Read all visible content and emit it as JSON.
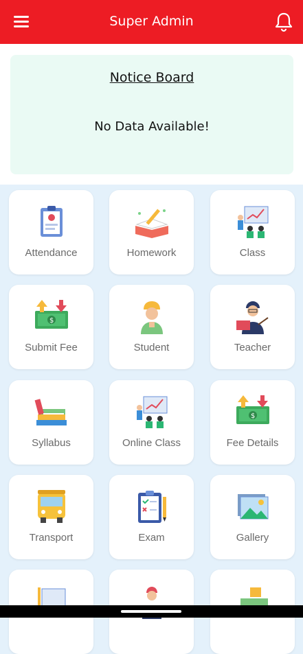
{
  "header": {
    "title": "Super Admin",
    "menu_icon": "hamburger-icon",
    "notification_icon": "bell-icon",
    "bg_color": "#ed1c24"
  },
  "notice_board": {
    "title": "Notice Board",
    "message": "No Data Available!"
  },
  "tiles": [
    {
      "label": "Attendance",
      "icon": "attendance-icon"
    },
    {
      "label": "Homework",
      "icon": "homework-icon"
    },
    {
      "label": "Class",
      "icon": "class-icon"
    },
    {
      "label": "Submit Fee",
      "icon": "submit-fee-icon"
    },
    {
      "label": "Student",
      "icon": "student-icon"
    },
    {
      "label": "Teacher",
      "icon": "teacher-icon"
    },
    {
      "label": "Syllabus",
      "icon": "syllabus-icon"
    },
    {
      "label": "Online Class",
      "icon": "online-class-icon"
    },
    {
      "label": "Fee Details",
      "icon": "fee-details-icon"
    },
    {
      "label": "Transport",
      "icon": "transport-icon"
    },
    {
      "label": "Exam",
      "icon": "exam-icon"
    },
    {
      "label": "Gallery",
      "icon": "gallery-icon"
    }
  ]
}
